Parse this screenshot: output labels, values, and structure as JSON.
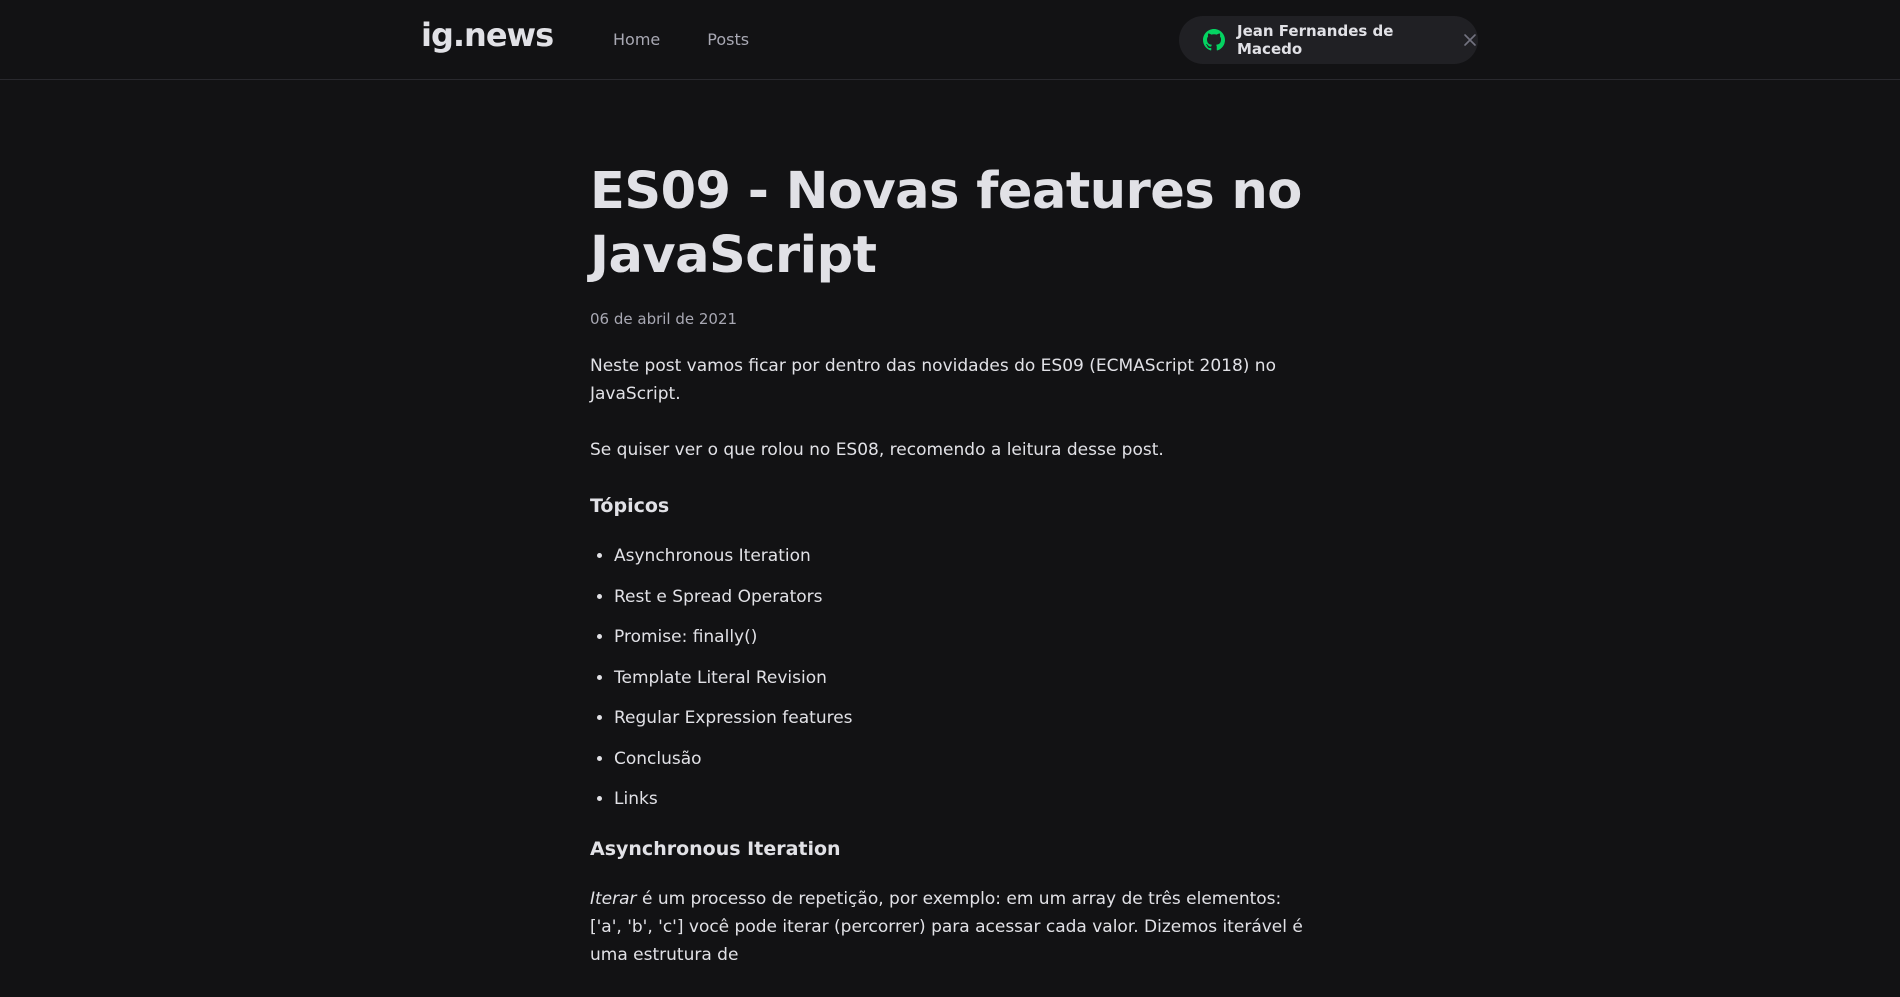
{
  "header": {
    "logo": "ig.news",
    "nav": [
      {
        "label": "Home"
      },
      {
        "label": "Posts"
      }
    ],
    "user": {
      "name": "Jean Fernandes de Macedo",
      "github_icon_color": "#04d361"
    }
  },
  "post": {
    "title": "ES09 - Novas features no JavaScript",
    "date": "06 de abril de 2021",
    "intro": "Neste post vamos ficar por dentro das novidades do ES09 (ECMAScript 2018) no JavaScript.",
    "es08_note": "Se quiser ver o que rolou no ES08, recomendo a leitura desse post.",
    "topics_heading": "Tópicos",
    "topics": [
      "Asynchronous Iteration",
      "Rest e Spread Operators",
      "Promise: finally()",
      "Template Literal Revision",
      "Regular Expression features",
      "Conclusão",
      "Links"
    ],
    "section1_heading": "Asynchronous Iteration",
    "section1_para_em": "Iterar",
    "section1_para_rest": " é um processo de repetição, por exemplo: em um array de três elementos: ['a', 'b', 'c'] você pode iterar (percorrer) para acessar cada valor. Dizemos iterável é uma estrutura de"
  },
  "colors": {
    "background": "#121214",
    "header_border": "#29292e",
    "text": "#e1e1e6",
    "muted": "#a8a8b3",
    "accent_green": "#04d361",
    "button_bg": "#202024"
  }
}
